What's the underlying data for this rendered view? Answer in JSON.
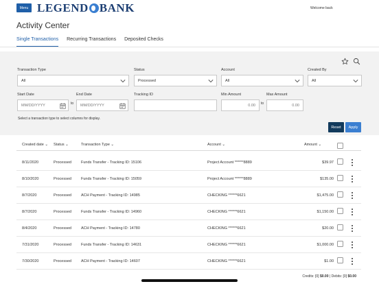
{
  "header": {
    "menu_label": "Menu",
    "logo_left": "LEGEND",
    "logo_right": "BANK",
    "welcome": "Welcome back"
  },
  "page": {
    "title": "Activity Center"
  },
  "tabs": [
    {
      "label": "Single Transactions",
      "active": true
    },
    {
      "label": "Recurring Transactions",
      "active": false
    },
    {
      "label": "Deposited Checks",
      "active": false
    }
  ],
  "filters": {
    "transaction_type": {
      "label": "Transaction Type",
      "value": "All"
    },
    "status": {
      "label": "Status",
      "value": "Processed"
    },
    "account": {
      "label": "Account",
      "value": "All"
    },
    "created_by": {
      "label": "Created By",
      "value": "All"
    },
    "start_date": {
      "label": "Start Date",
      "placeholder": "MM/DD/YYYY"
    },
    "end_date": {
      "label": "End Date",
      "placeholder": "MM/DD/YYYY"
    },
    "to_label": "to",
    "tracking_id": {
      "label": "Tracking ID",
      "value": ""
    },
    "min_amount": {
      "label": "Min Amount",
      "value": "0.00"
    },
    "max_amount": {
      "label": "Max Amount",
      "value": "0.00"
    },
    "hint": "Select a transaction type to select columns for display.",
    "reset_label": "Reset",
    "apply_label": "Apply"
  },
  "table": {
    "headers": {
      "created_date": "Created date",
      "status": "Status",
      "transaction_type": "Transaction Type",
      "account": "Account",
      "amount": "Amount"
    },
    "rows": [
      {
        "date": "8/11/2020",
        "status": "Processed",
        "type": "Funds Transfer - Tracking ID: 15106",
        "account": "Project Account ******8889",
        "amount": "$39.97"
      },
      {
        "date": "8/10/2020",
        "status": "Processed",
        "type": "Funds Transfer - Tracking ID: 15059",
        "account": "Project Account ******8889",
        "amount": "$135.00"
      },
      {
        "date": "8/7/2020",
        "status": "Processed",
        "type": "ACH Payment - Tracking ID: 14985",
        "account": "CHECKING ******6621",
        "amount": "$1,475.00"
      },
      {
        "date": "8/7/2020",
        "status": "Processed",
        "type": "Funds Transfer - Tracking ID: 14960",
        "account": "CHECKING ******6621",
        "amount": "$1,150.00"
      },
      {
        "date": "8/4/2020",
        "status": "Processed",
        "type": "ACH Payment - Tracking ID: 14780",
        "account": "CHECKING ******6621",
        "amount": "$20.00"
      },
      {
        "date": "7/31/2020",
        "status": "Processed",
        "type": "Funds Transfer - Tracking ID: 14631",
        "account": "CHECKING ******6621",
        "amount": "$1,000.00"
      },
      {
        "date": "7/30/2020",
        "status": "Processed",
        "type": "ACH Payment - Tracking ID: 14607",
        "account": "CHECKING ******6621",
        "amount": "$1.00"
      }
    ]
  },
  "totals": {
    "credits_label": "Credits: [0]",
    "credits_value": "$0.00",
    "separator": "|",
    "debits_label": "Debits: [0]",
    "debits_value": "$0.00"
  },
  "icons": {
    "favorite": "star-icon",
    "search": "search-icon",
    "dropdown": "chevron-down-icon",
    "calendar": "calendar-icon",
    "more": "kebab-menu-icon"
  },
  "colors": {
    "brand": "#1f5fa8",
    "reset_button": "#123a5c",
    "apply_button": "#3b7fd1"
  }
}
